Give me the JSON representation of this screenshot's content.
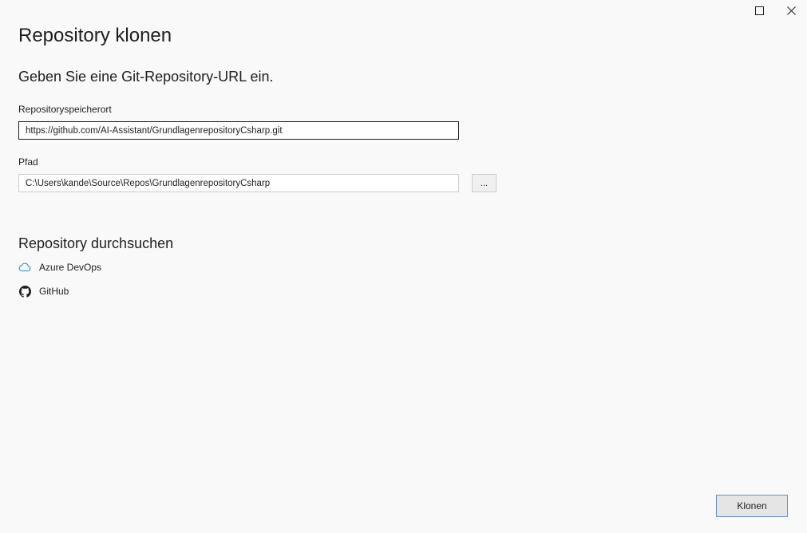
{
  "window": {
    "maximize_icon": "maximize-icon",
    "close_icon": "close-icon"
  },
  "header": {
    "title": "Repository klonen",
    "subtitle": "Geben Sie eine Git-Repository-URL ein."
  },
  "form": {
    "url_label": "Repositoryspeicherort",
    "url_value": "https://github.com/AI-Assistant/GrundlagenrepositoryCsharp.git",
    "path_label": "Pfad",
    "path_value": "C:\\Users\\kande\\Source\\Repos\\GrundlagenrepositoryCsharp",
    "browse_label": "..."
  },
  "browse": {
    "title": "Repository durchsuchen",
    "providers": [
      {
        "label": "Azure DevOps",
        "icon": "cloud-icon"
      },
      {
        "label": "GitHub",
        "icon": "github-icon"
      }
    ]
  },
  "footer": {
    "clone_label": "Klonen"
  },
  "colors": {
    "background": "#f9f9f9",
    "accent": "#1e90e0",
    "button_border": "#6a8fc9"
  }
}
